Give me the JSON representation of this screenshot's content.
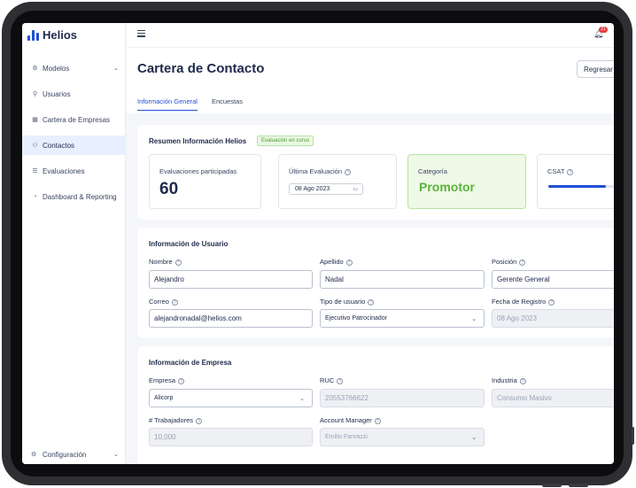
{
  "app": {
    "logo_text": "Helios",
    "notification_count": "21"
  },
  "sidebar": {
    "items": [
      {
        "label": "Modelos",
        "icon": "sliders-icon"
      },
      {
        "label": "Usuarios",
        "icon": "user-icon"
      },
      {
        "label": "Cartera de Empresas",
        "icon": "building-icon"
      },
      {
        "label": "Contactos",
        "icon": "contacts-icon"
      },
      {
        "label": "Evaluaciones",
        "icon": "list-icon"
      },
      {
        "label": "Dashboard & Reporting",
        "icon": "pie-chart-icon"
      }
    ],
    "footer_label": "Configuración"
  },
  "header": {
    "title": "Cartera de Contacto",
    "back_button": "Regresar",
    "tabs": [
      "Información General",
      "Encuestas"
    ]
  },
  "summary": {
    "title": "Resumen Información Helios",
    "status_badge": "Evaluación en curso",
    "evaluations_label": "Evaluaciones participadas",
    "evaluations_value": "60",
    "last_eval_label": "Última Evaluación",
    "last_eval_date": "08 Ago 2023",
    "category_label": "Categoría",
    "category_value": "Promotor",
    "csat_label": "CSAT",
    "csat_level": 0.83
  },
  "user_info": {
    "title": "Información de Usuario",
    "nombre_label": "Nombre",
    "nombre_value": "Alejandro",
    "apellido_label": "Apellido",
    "apellido_value": "Nadal",
    "posicion_label": "Posición",
    "posicion_value": "Gerente General",
    "correo_label": "Correo",
    "correo_value": "alejandronadal@helios.com",
    "tipo_label": "Tipo de usuario",
    "tipo_value": "Ejecutivo Patrocinador",
    "fecha_label": "Fecha de Registro",
    "fecha_value": "08 Ago 2023"
  },
  "company_info": {
    "title": "Información de Empresa",
    "empresa_label": "Empresa",
    "empresa_value": "Alicorp",
    "ruc_label": "RUC",
    "ruc_value": "20553766622",
    "industria_label": "Industria",
    "industria_value": "Consumo Masivo",
    "trabajadores_label": "# Trabajadores",
    "trabajadores_value": "10,000",
    "manager_label": "Account Manager",
    "manager_value": "Emilio Fanrazzi"
  }
}
